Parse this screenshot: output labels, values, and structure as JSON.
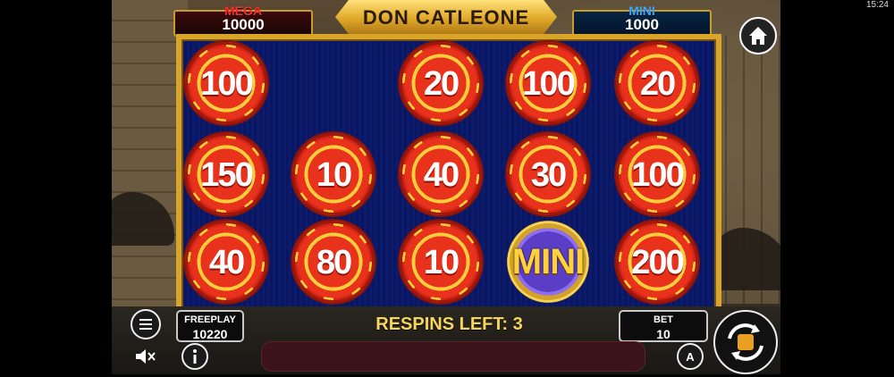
{
  "status_bar": {
    "time": "15:24"
  },
  "header": {
    "title": "DON CATLEONE"
  },
  "jackpots": {
    "mega": {
      "label": "MEGA",
      "amount": "10000"
    },
    "mini": {
      "label": "MINI",
      "amount": "1000"
    }
  },
  "grid": {
    "rows": [
      [
        "100",
        "",
        "20",
        "100",
        "20"
      ],
      [
        "150",
        "10",
        "40",
        "30",
        "100"
      ],
      [
        "40",
        "80",
        "10",
        "MINI",
        "200"
      ]
    ]
  },
  "footer": {
    "freeplay": {
      "label": "FREEPLAY",
      "value": "10220"
    },
    "respins": "RESPINS LEFT: 3",
    "bet": {
      "label": "BET",
      "value": "10"
    }
  },
  "icons": {
    "home": "home-icon",
    "menu": "menu-icon",
    "sound": "sound-muted-icon",
    "info": "info-icon",
    "autoplay": "autoplay-icon",
    "spin": "spin-icon"
  }
}
